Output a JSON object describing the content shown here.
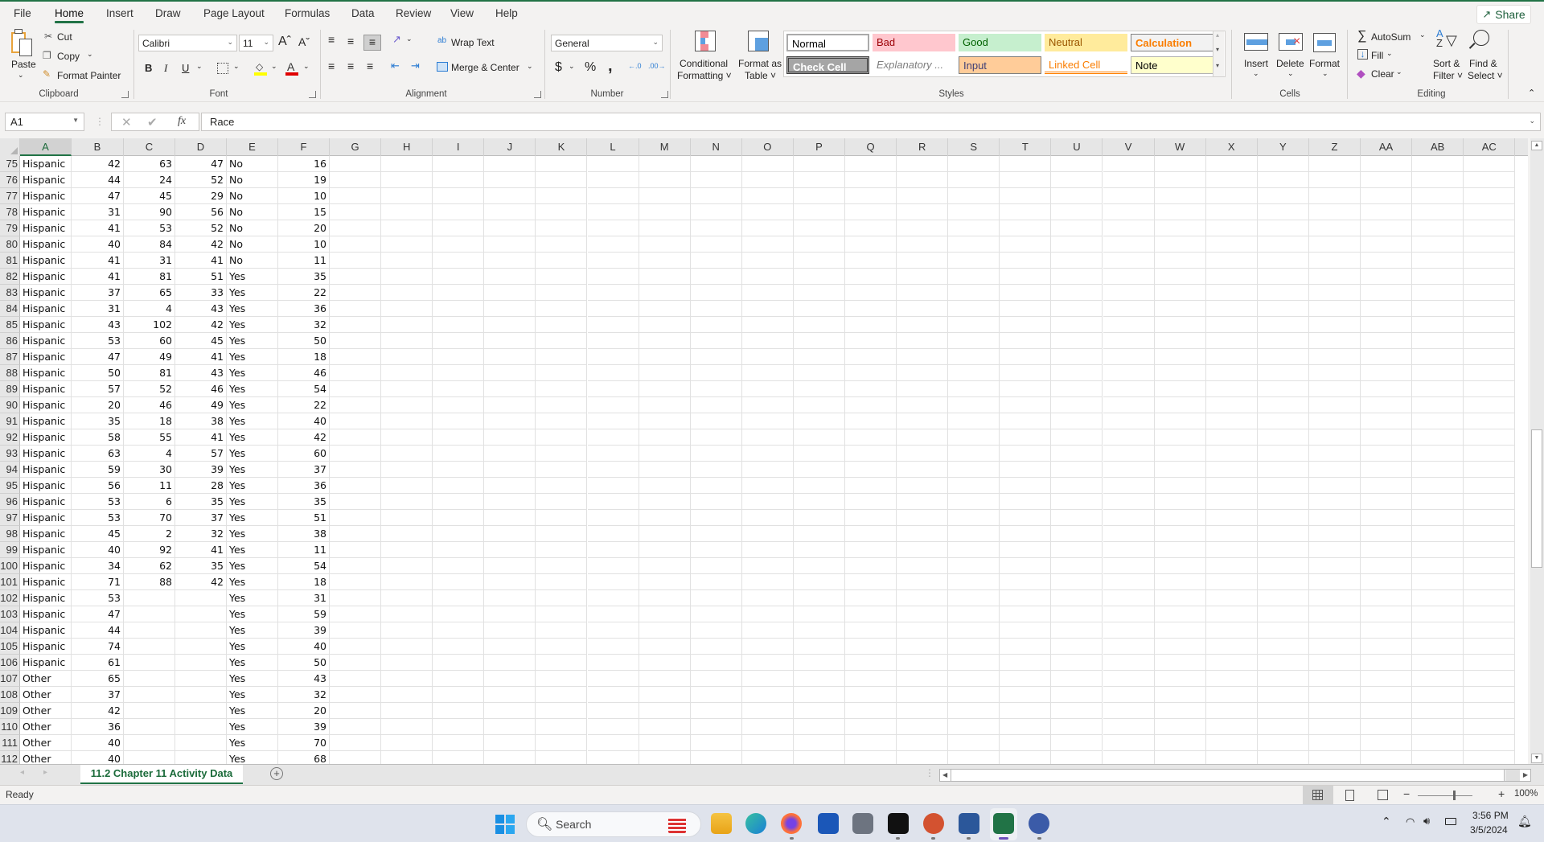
{
  "menu": {
    "tabs": [
      "File",
      "Home",
      "Insert",
      "Draw",
      "Page Layout",
      "Formulas",
      "Data",
      "Review",
      "View",
      "Help"
    ],
    "active_tab": "Home",
    "share_label": "Share"
  },
  "ribbon": {
    "clipboard": {
      "group_label": "Clipboard",
      "paste": "Paste",
      "cut": "Cut",
      "copy": "Copy",
      "format_painter": "Format Painter"
    },
    "font": {
      "group_label": "Font",
      "font_name": "Calibri",
      "font_size": "11",
      "bold": "B",
      "italic": "I",
      "underline": "U",
      "increase_size": "Aˆ",
      "decrease_size": "Aˇ",
      "highlight_color": "#ffff00",
      "font_color": "#e00000"
    },
    "alignment": {
      "group_label": "Alignment",
      "wrap_text": "Wrap Text",
      "merge_center": "Merge & Center"
    },
    "number": {
      "group_label": "Number",
      "format": "General",
      "currency": "$",
      "percent": "%",
      "comma": ","
    },
    "styles": {
      "group_label": "Styles",
      "conditional_formatting": [
        "Conditional",
        "Formatting ˅"
      ],
      "format_as_table": [
        "Format as",
        "Table ˅"
      ],
      "cells": [
        {
          "label": "Normal",
          "bg": "#ffffff",
          "fg": "#000000"
        },
        {
          "label": "Bad",
          "bg": "#ffc7ce",
          "fg": "#9c0006"
        },
        {
          "label": "Good",
          "bg": "#c6efce",
          "fg": "#006100"
        },
        {
          "label": "Neutral",
          "bg": "#ffeb9c",
          "fg": "#9c5700"
        },
        {
          "label": "Calculation",
          "bg": "#f2f2f2",
          "fg": "#fa7d00"
        },
        {
          "label": "Check Cell",
          "bg": "#a5a5a5",
          "fg": "#ffffff"
        },
        {
          "label": "Explanatory ...",
          "bg": "#ffffff",
          "fg": "#7f7f7f"
        },
        {
          "label": "Input",
          "bg": "#ffcc99",
          "fg": "#3f3f76"
        },
        {
          "label": "Linked Cell",
          "bg": "#ffffff",
          "fg": "#fa7d00"
        },
        {
          "label": "Note",
          "bg": "#ffffcc",
          "fg": "#000000"
        }
      ]
    },
    "cells": {
      "group_label": "Cells",
      "insert": "Insert",
      "delete": "Delete",
      "format": "Format"
    },
    "editing": {
      "group_label": "Editing",
      "autosum": "AutoSum",
      "fill": "Fill",
      "clear": "Clear",
      "sort_filter": [
        "Sort &",
        "Filter ˅"
      ],
      "find_select": [
        "Find &",
        "Select ˅"
      ]
    }
  },
  "formula_bar": {
    "name_box": "A1",
    "fx": "fx",
    "formula": "Race"
  },
  "sheet": {
    "columns": [
      "A",
      "B",
      "C",
      "D",
      "E",
      "F",
      "G",
      "H",
      "I",
      "J",
      "K",
      "L",
      "M",
      "N",
      "O",
      "P",
      "Q",
      "R",
      "S",
      "T",
      "U",
      "V",
      "W",
      "X",
      "Y",
      "Z",
      "AA",
      "AB",
      "AC"
    ],
    "selected_column": "A",
    "rows": [
      {
        "n": "75",
        "c": [
          "Hispanic",
          "42",
          "63",
          "47",
          "No",
          "16"
        ]
      },
      {
        "n": "76",
        "c": [
          "Hispanic",
          "44",
          "24",
          "52",
          "No",
          "19"
        ]
      },
      {
        "n": "77",
        "c": [
          "Hispanic",
          "47",
          "45",
          "29",
          "No",
          "10"
        ]
      },
      {
        "n": "78",
        "c": [
          "Hispanic",
          "31",
          "90",
          "56",
          "No",
          "15"
        ]
      },
      {
        "n": "79",
        "c": [
          "Hispanic",
          "41",
          "53",
          "52",
          "No",
          "20"
        ]
      },
      {
        "n": "80",
        "c": [
          "Hispanic",
          "40",
          "84",
          "42",
          "No",
          "10"
        ]
      },
      {
        "n": "81",
        "c": [
          "Hispanic",
          "41",
          "31",
          "41",
          "No",
          "11"
        ]
      },
      {
        "n": "82",
        "c": [
          "Hispanic",
          "41",
          "81",
          "51",
          "Yes",
          "35"
        ]
      },
      {
        "n": "83",
        "c": [
          "Hispanic",
          "37",
          "65",
          "33",
          "Yes",
          "22"
        ]
      },
      {
        "n": "84",
        "c": [
          "Hispanic",
          "31",
          "4",
          "43",
          "Yes",
          "36"
        ]
      },
      {
        "n": "85",
        "c": [
          "Hispanic",
          "43",
          "102",
          "42",
          "Yes",
          "32"
        ]
      },
      {
        "n": "86",
        "c": [
          "Hispanic",
          "53",
          "60",
          "45",
          "Yes",
          "50"
        ]
      },
      {
        "n": "87",
        "c": [
          "Hispanic",
          "47",
          "49",
          "41",
          "Yes",
          "18"
        ]
      },
      {
        "n": "88",
        "c": [
          "Hispanic",
          "50",
          "81",
          "43",
          "Yes",
          "46"
        ]
      },
      {
        "n": "89",
        "c": [
          "Hispanic",
          "57",
          "52",
          "46",
          "Yes",
          "54"
        ]
      },
      {
        "n": "90",
        "c": [
          "Hispanic",
          "20",
          "46",
          "49",
          "Yes",
          "22"
        ]
      },
      {
        "n": "91",
        "c": [
          "Hispanic",
          "35",
          "18",
          "38",
          "Yes",
          "40"
        ]
      },
      {
        "n": "92",
        "c": [
          "Hispanic",
          "58",
          "55",
          "41",
          "Yes",
          "42"
        ]
      },
      {
        "n": "93",
        "c": [
          "Hispanic",
          "63",
          "4",
          "57",
          "Yes",
          "60"
        ]
      },
      {
        "n": "94",
        "c": [
          "Hispanic",
          "59",
          "30",
          "39",
          "Yes",
          "37"
        ]
      },
      {
        "n": "95",
        "c": [
          "Hispanic",
          "56",
          "11",
          "28",
          "Yes",
          "36"
        ]
      },
      {
        "n": "96",
        "c": [
          "Hispanic",
          "53",
          "6",
          "35",
          "Yes",
          "35"
        ]
      },
      {
        "n": "97",
        "c": [
          "Hispanic",
          "53",
          "70",
          "37",
          "Yes",
          "51"
        ]
      },
      {
        "n": "98",
        "c": [
          "Hispanic",
          "45",
          "2",
          "32",
          "Yes",
          "38"
        ]
      },
      {
        "n": "99",
        "c": [
          "Hispanic",
          "40",
          "92",
          "41",
          "Yes",
          "11"
        ]
      },
      {
        "n": "100",
        "c": [
          "Hispanic",
          "34",
          "62",
          "35",
          "Yes",
          "54"
        ]
      },
      {
        "n": "101",
        "c": [
          "Hispanic",
          "71",
          "88",
          "42",
          "Yes",
          "18"
        ]
      },
      {
        "n": "102",
        "c": [
          "Hispanic",
          "53",
          "",
          "",
          "Yes",
          "31"
        ]
      },
      {
        "n": "103",
        "c": [
          "Hispanic",
          "47",
          "",
          "",
          "Yes",
          "59"
        ]
      },
      {
        "n": "104",
        "c": [
          "Hispanic",
          "44",
          "",
          "",
          "Yes",
          "39"
        ]
      },
      {
        "n": "105",
        "c": [
          "Hispanic",
          "74",
          "",
          "",
          "Yes",
          "40"
        ]
      },
      {
        "n": "106",
        "c": [
          "Hispanic",
          "61",
          "",
          "",
          "Yes",
          "50"
        ]
      },
      {
        "n": "107",
        "c": [
          "Other",
          "65",
          "",
          "",
          "Yes",
          "43"
        ]
      },
      {
        "n": "108",
        "c": [
          "Other",
          "37",
          "",
          "",
          "Yes",
          "32"
        ]
      },
      {
        "n": "109",
        "c": [
          "Other",
          "42",
          "",
          "",
          "Yes",
          "20"
        ]
      },
      {
        "n": "110",
        "c": [
          "Other",
          "36",
          "",
          "",
          "Yes",
          "39"
        ]
      },
      {
        "n": "111",
        "c": [
          "Other",
          "40",
          "",
          "",
          "Yes",
          "70"
        ]
      },
      {
        "n": "112",
        "c": [
          "Other",
          "40",
          "",
          "",
          "Yes",
          "68"
        ]
      }
    ],
    "tab_name": "11.2 Chapter 11 Activity Data"
  },
  "status": {
    "mode": "Ready",
    "zoom": "100%"
  },
  "taskbar": {
    "search_placeholder": "Search",
    "time": "3:56 PM",
    "date": "3/5/2024"
  }
}
